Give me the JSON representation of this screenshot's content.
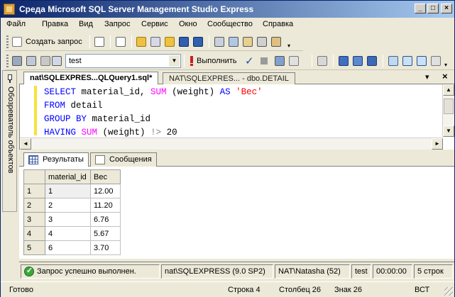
{
  "window": {
    "title": "Среда Microsoft SQL Server Management Studio Express",
    "min_label": "_",
    "max_label": "□",
    "close_label": "×"
  },
  "menu": {
    "items": [
      {
        "label": "Файл"
      },
      {
        "label": "Правка"
      },
      {
        "label": "Вид"
      },
      {
        "label": "Запрос"
      },
      {
        "label": "Сервис"
      },
      {
        "label": "Окно"
      },
      {
        "label": "Сообщество"
      },
      {
        "label": "Справка"
      }
    ]
  },
  "toolbar1": {
    "new_query_label": "Создать запрос"
  },
  "toolbar2": {
    "database_value": "test",
    "execute_label": "Выполнить"
  },
  "side_panel": {
    "label": "Обозреватель объектов"
  },
  "doc_tabs": [
    {
      "label": "nat\\SQLEXPRES...QLQuery1.sql*",
      "active": true
    },
    {
      "label": "NAT\\SQLEXPRES... - dbo.DETAIL",
      "active": false
    }
  ],
  "doc_tabs_controls": {
    "dropdown": "▾",
    "close": "×"
  },
  "editor": {
    "lines": [
      [
        {
          "t": "SELECT",
          "c": "kw"
        },
        {
          "t": " material_id, ",
          "c": "id"
        },
        {
          "t": "SUM",
          "c": "fn"
        },
        {
          "t": " (weight) ",
          "c": "id"
        },
        {
          "t": "AS",
          "c": "kw"
        },
        {
          "t": " ",
          "c": "id"
        },
        {
          "t": "'Вес'",
          "c": "str"
        }
      ],
      [
        {
          "t": "FROM",
          "c": "kw"
        },
        {
          "t": " detail",
          "c": "id"
        }
      ],
      [
        {
          "t": "GROUP BY",
          "c": "kw"
        },
        {
          "t": " material_id",
          "c": "id"
        }
      ],
      [
        {
          "t": "HAVING",
          "c": "kw"
        },
        {
          "t": " ",
          "c": "id"
        },
        {
          "t": "SUM",
          "c": "fn"
        },
        {
          "t": " (weight) ",
          "c": "id"
        },
        {
          "t": "!>",
          "c": "op"
        },
        {
          "t": " 20",
          "c": "id"
        }
      ]
    ]
  },
  "results_tabs": [
    {
      "label": "Результаты",
      "active": true
    },
    {
      "label": "Сообщения",
      "active": false
    }
  ],
  "grid": {
    "columns": [
      "material_id",
      "Вес"
    ],
    "rows": [
      {
        "n": "1",
        "material_id": "1",
        "ves": "12.00"
      },
      {
        "n": "2",
        "material_id": "2",
        "ves": "11.20"
      },
      {
        "n": "3",
        "material_id": "3",
        "ves": "6.76"
      },
      {
        "n": "4",
        "material_id": "4",
        "ves": "5.67"
      },
      {
        "n": "5",
        "material_id": "6",
        "ves": "3.70"
      }
    ]
  },
  "query_status": {
    "message": "Запрос успешно выполнен.",
    "server": "nat\\SQLEXPRESS (9.0 SP2)",
    "user": "NAT\\Natasha (52)",
    "database": "test",
    "elapsed": "00:00:00",
    "rows": "5 строк"
  },
  "status_bar": {
    "ready": "Готово",
    "line": "Строка 4",
    "column": "Столбец 26",
    "char": "Знак 26",
    "mode": "ВСТ"
  },
  "colors": {
    "keyword": "#0000ff",
    "function": "#ff00ff",
    "string": "#ff0000",
    "operator": "#808080",
    "titlebar_start": "#0a246a",
    "titlebar_end": "#a6caf0"
  }
}
